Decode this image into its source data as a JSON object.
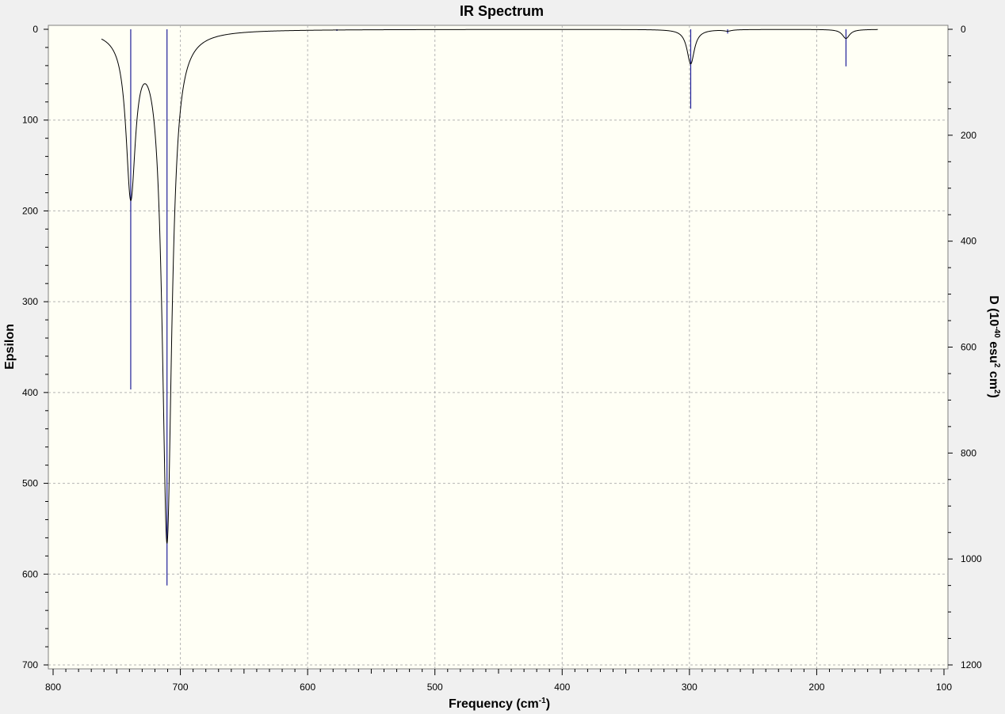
{
  "chart_data": {
    "type": "line",
    "title": "IR Spectrum",
    "xlabel": {
      "text": "Frequency (cm",
      "sup": "-1",
      "tail": ")"
    },
    "ylabel": "Epsilon",
    "y2label": {
      "p1": "D (10",
      "s1": "-40",
      "p2": " esu",
      "s2": "2",
      "p3": " cm",
      "s3": "2",
      "p4": ")"
    },
    "xlim": [
      800,
      100
    ],
    "xticks": [
      "800",
      "700",
      "600",
      "500",
      "400",
      "300",
      "200",
      "100"
    ],
    "ylim": [
      700,
      0
    ],
    "yticks": [
      "0",
      "100",
      "200",
      "300",
      "400",
      "500",
      "600",
      "700"
    ],
    "y2lim": [
      1200,
      0
    ],
    "y2ticks": [
      "0",
      "200",
      "400",
      "600",
      "800",
      "1000",
      "1200"
    ],
    "grid": true,
    "spectrum_range": [
      762,
      152
    ],
    "peaks": [
      {
        "freq": 739,
        "epsilon": 175,
        "width": 4.5
      },
      {
        "freq": 710.5,
        "epsilon": 562,
        "width": 4.5
      },
      {
        "freq": 299,
        "epsilon": 38,
        "width": 3.5
      },
      {
        "freq": 270,
        "epsilon": 1.5,
        "width": 3.5
      },
      {
        "freq": 177,
        "epsilon": 10,
        "width": 3.5
      }
    ],
    "sticks": [
      {
        "freq": 739,
        "intensity": 680
      },
      {
        "freq": 710.5,
        "intensity": 1050
      },
      {
        "freq": 299,
        "intensity": 150
      },
      {
        "freq": 270,
        "intensity": 8
      },
      {
        "freq": 577,
        "intensity": 3
      },
      {
        "freq": 177,
        "intensity": 70
      }
    ],
    "colors": {
      "plot_background": "#fffff5",
      "spectrum_line": "#000000",
      "stick_lines": "#1f1f99",
      "grid": "#b4b4b4"
    }
  }
}
